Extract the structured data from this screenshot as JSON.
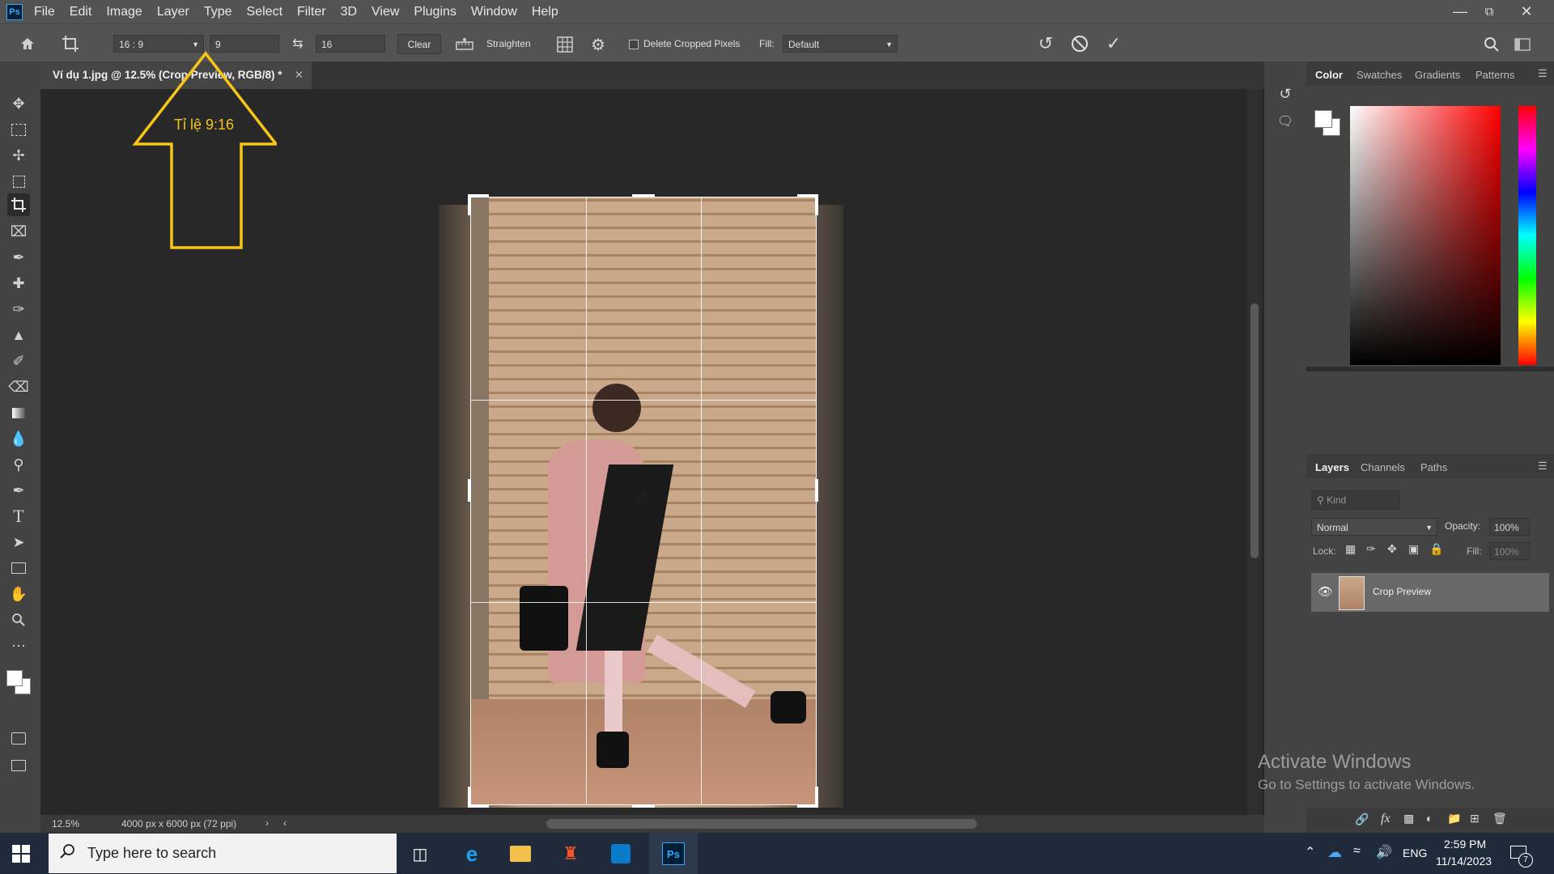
{
  "menu": [
    "File",
    "Edit",
    "Image",
    "Layer",
    "Type",
    "Select",
    "Filter",
    "3D",
    "View",
    "Plugins",
    "Window",
    "Help"
  ],
  "app_logo": "Ps",
  "options": {
    "ratio_preset": "16 : 9",
    "width_value": "9",
    "height_value": "16",
    "clear_label": "Clear",
    "straighten_label": "Straighten",
    "delete_cropped_label": "Delete Cropped Pixels",
    "fill_label": "Fill:",
    "fill_value": "Default"
  },
  "document": {
    "tab_title": "Ví dụ 1.jpg @ 12.5% (Crop Preview, RGB/8) *",
    "zoom": "12.5%",
    "info": "4000 px x 6000 px (72 ppi)"
  },
  "annotation": {
    "text": "Tỉ lệ 9:16",
    "color": "#f5c518"
  },
  "color_panel": {
    "tabs": [
      "Color",
      "Swatches",
      "Gradients",
      "Patterns"
    ]
  },
  "layers_panel": {
    "tabs": [
      "Layers",
      "Channels",
      "Paths"
    ],
    "kind_placeholder": "Kind",
    "blend_mode": "Normal",
    "opacity_label": "Opacity:",
    "opacity_value": "100%",
    "lock_label": "Lock:",
    "fill_label": "Fill:",
    "fill_value": "100%",
    "layers": [
      {
        "name": "Crop Preview"
      }
    ]
  },
  "watermark": {
    "title": "Activate Windows",
    "subtitle": "Go to Settings to activate Windows."
  },
  "taskbar": {
    "search_placeholder": "Type here to search",
    "language": "ENG",
    "time": "2:59 PM",
    "date": "11/14/2023",
    "notification_count": "7"
  },
  "colors": {
    "accent": "#31a8ff",
    "annotation": "#f5c518",
    "photoshop_bg": "#282828"
  }
}
